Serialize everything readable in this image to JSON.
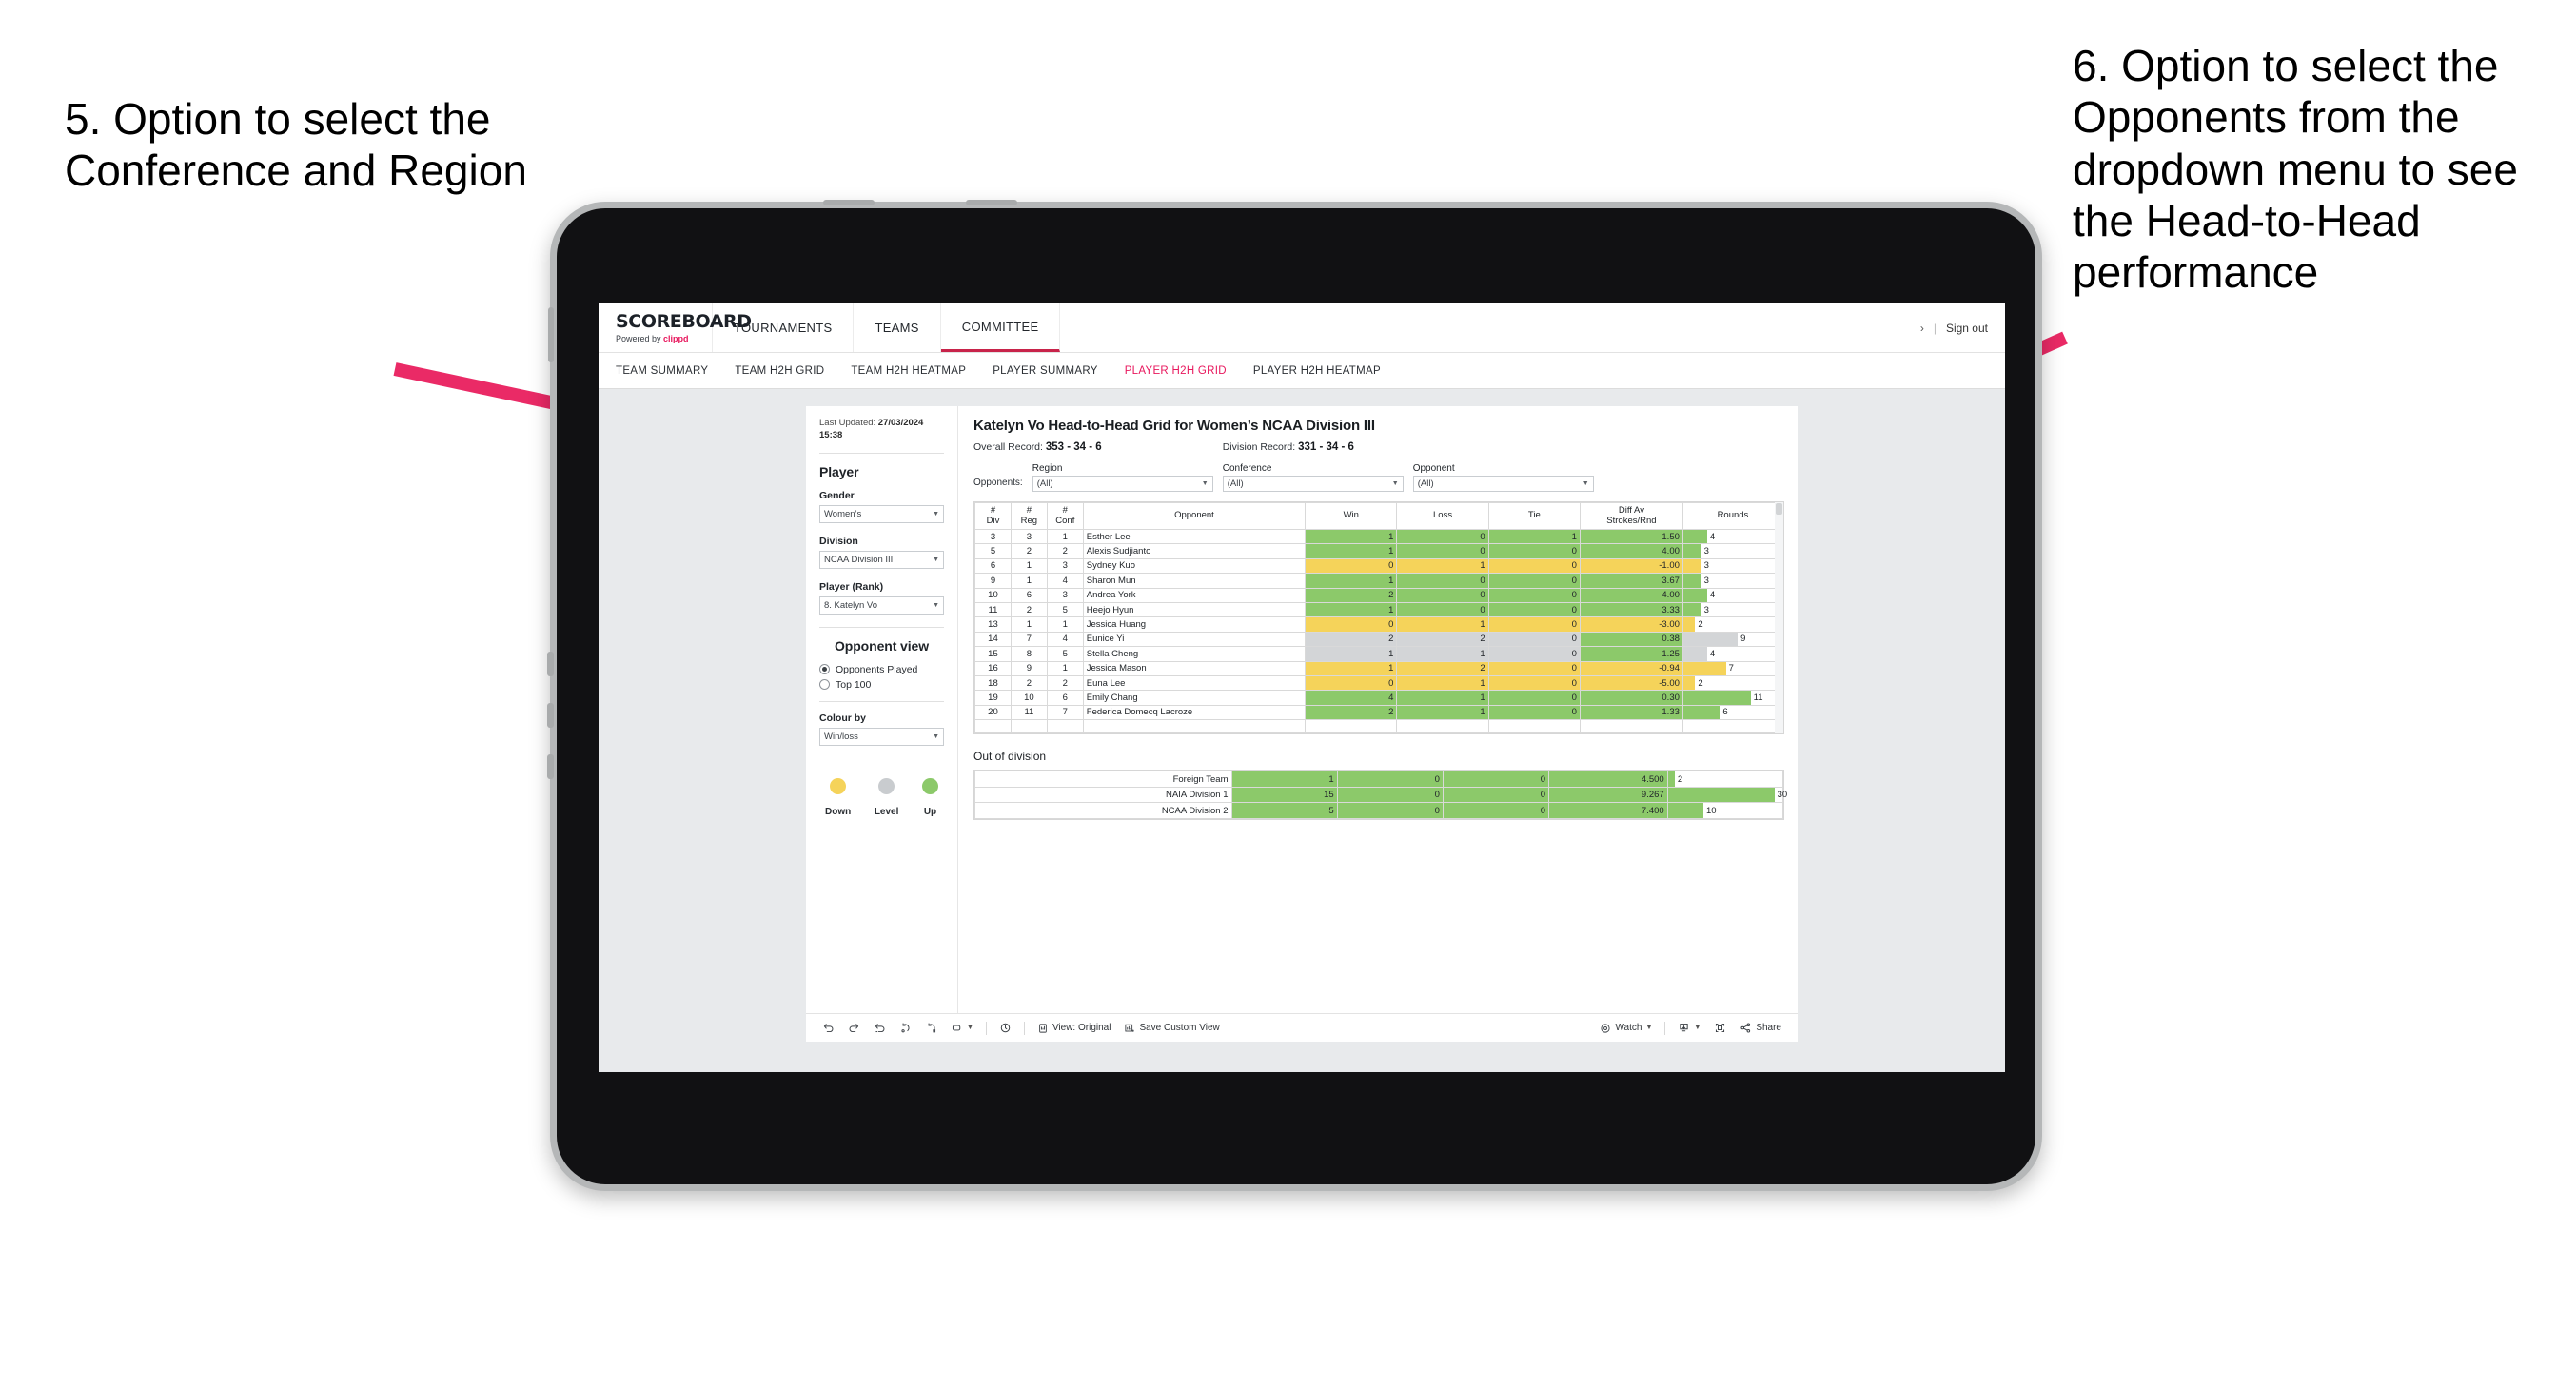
{
  "annotations": {
    "left": "5. Option to select the Conference and Region",
    "right": "6. Option to select the Opponents from the dropdown menu to see the Head-to-Head performance"
  },
  "app": {
    "brand": {
      "title": "SCOREBOARD",
      "powered_prefix": "Powered by",
      "powered_name": "clippd"
    },
    "topnav": [
      {
        "label": "TOURNAMENTS",
        "active": false
      },
      {
        "label": "TEAMS",
        "active": false
      },
      {
        "label": "COMMITTEE",
        "active": true
      }
    ],
    "topnav_right": {
      "user_glyph": "›",
      "separator": "|",
      "sign_out": "Sign out"
    },
    "subnav": [
      {
        "label": "TEAM SUMMARY",
        "active": false
      },
      {
        "label": "TEAM H2H GRID",
        "active": false
      },
      {
        "label": "TEAM H2H HEATMAP",
        "active": false
      },
      {
        "label": "PLAYER SUMMARY",
        "active": false
      },
      {
        "label": "PLAYER H2H GRID",
        "active": true
      },
      {
        "label": "PLAYER H2H HEATMAP",
        "active": false
      }
    ]
  },
  "panel": {
    "last_updated_label": "Last Updated:",
    "last_updated_date": "27/03/2024",
    "last_updated_time": "15:38",
    "player_heading": "Player",
    "gender_label": "Gender",
    "gender_value": "Women’s",
    "division_label": "Division",
    "division_value": "NCAA Division III",
    "player_rank_label": "Player (Rank)",
    "player_rank_value": "8. Katelyn Vo",
    "opponent_view_heading": "Opponent view",
    "opponent_view_options": [
      {
        "label": "Opponents Played",
        "selected": true
      },
      {
        "label": "Top 100",
        "selected": false
      }
    ],
    "colour_by_label": "Colour by",
    "colour_by_value": "Win/loss",
    "legend": [
      {
        "label": "Down",
        "color": "#F5D35A"
      },
      {
        "label": "Level",
        "color": "#C9CCCF"
      },
      {
        "label": "Up",
        "color": "#8CC96A"
      }
    ]
  },
  "view": {
    "title": "Katelyn Vo Head-to-Head Grid for Women’s NCAA Division III",
    "overall_record_label": "Overall Record:",
    "overall_record_value": "353 -  34 - 6",
    "division_record_label": "Division Record:",
    "division_record_value": "331 -  34 - 6",
    "opponents_label": "Opponents:",
    "filters": [
      {
        "label": "Region",
        "value": "(All)"
      },
      {
        "label": "Conference",
        "value": "(All)"
      },
      {
        "label": "Opponent",
        "value": "(All)"
      }
    ]
  },
  "chart_data": {
    "type": "table",
    "title": "Katelyn Vo Head-to-Head Grid for Women’s NCAA Division III",
    "columns": [
      "# Div",
      "# Reg",
      "# Conf",
      "Opponent",
      "Win",
      "Loss",
      "Tie",
      "Diff Av Strokes/Rnd",
      "Rounds"
    ],
    "column_header_lines": [
      [
        "#",
        "Div"
      ],
      [
        "#",
        "Reg"
      ],
      [
        "#",
        "Conf"
      ],
      [
        "Opponent"
      ],
      [
        "Win"
      ],
      [
        "Loss"
      ],
      [
        "Tie"
      ],
      [
        "Diff Av",
        "Strokes/Rnd"
      ],
      [
        "Rounds"
      ]
    ],
    "rows": [
      {
        "div": "3",
        "reg": "3",
        "conf": "1",
        "opponent": "Esther Lee",
        "win": "1",
        "loss": "0",
        "tie": "1",
        "diff": "1.50",
        "rounds": "4",
        "color": "#8CC96A",
        "diff_color": "#8CC96A",
        "bar_pct": 24
      },
      {
        "div": "5",
        "reg": "2",
        "conf": "2",
        "opponent": "Alexis Sudjianto",
        "win": "1",
        "loss": "0",
        "tie": "0",
        "diff": "4.00",
        "rounds": "3",
        "color": "#8CC96A",
        "diff_color": "#8CC96A",
        "bar_pct": 18
      },
      {
        "div": "6",
        "reg": "1",
        "conf": "3",
        "opponent": "Sydney Kuo",
        "win": "0",
        "loss": "1",
        "tie": "0",
        "diff": "-1.00",
        "rounds": "3",
        "color": "#F5D35A",
        "diff_color": "#F5D35A",
        "bar_pct": 18
      },
      {
        "div": "9",
        "reg": "1",
        "conf": "4",
        "opponent": "Sharon Mun",
        "win": "1",
        "loss": "0",
        "tie": "0",
        "diff": "3.67",
        "rounds": "3",
        "color": "#8CC96A",
        "diff_color": "#8CC96A",
        "bar_pct": 18
      },
      {
        "div": "10",
        "reg": "6",
        "conf": "3",
        "opponent": "Andrea York",
        "win": "2",
        "loss": "0",
        "tie": "0",
        "diff": "4.00",
        "rounds": "4",
        "color": "#8CC96A",
        "diff_color": "#8CC96A",
        "bar_pct": 24
      },
      {
        "div": "11",
        "reg": "2",
        "conf": "5",
        "opponent": "Heejo Hyun",
        "win": "1",
        "loss": "0",
        "tie": "0",
        "diff": "3.33",
        "rounds": "3",
        "color": "#8CC96A",
        "diff_color": "#8CC96A",
        "bar_pct": 18
      },
      {
        "div": "13",
        "reg": "1",
        "conf": "1",
        "opponent": "Jessica Huang",
        "win": "0",
        "loss": "1",
        "tie": "0",
        "diff": "-3.00",
        "rounds": "2",
        "color": "#F5D35A",
        "diff_color": "#F5D35A",
        "bar_pct": 12
      },
      {
        "div": "14",
        "reg": "7",
        "conf": "4",
        "opponent": "Eunice Yi",
        "win": "2",
        "loss": "2",
        "tie": "0",
        "diff": "0.38",
        "rounds": "9",
        "color": "#D3D5D7",
        "diff_color": "#8CC96A",
        "bar_pct": 55
      },
      {
        "div": "15",
        "reg": "8",
        "conf": "5",
        "opponent": "Stella Cheng",
        "win": "1",
        "loss": "1",
        "tie": "0",
        "diff": "1.25",
        "rounds": "4",
        "color": "#D3D5D7",
        "diff_color": "#8CC96A",
        "bar_pct": 24
      },
      {
        "div": "16",
        "reg": "9",
        "conf": "1",
        "opponent": "Jessica Mason",
        "win": "1",
        "loss": "2",
        "tie": "0",
        "diff": "-0.94",
        "rounds": "7",
        "color": "#F5D35A",
        "diff_color": "#F5D35A",
        "bar_pct": 43
      },
      {
        "div": "18",
        "reg": "2",
        "conf": "2",
        "opponent": "Euna Lee",
        "win": "0",
        "loss": "1",
        "tie": "0",
        "diff": "-5.00",
        "rounds": "2",
        "color": "#F5D35A",
        "diff_color": "#F5D35A",
        "bar_pct": 12
      },
      {
        "div": "19",
        "reg": "10",
        "conf": "6",
        "opponent": "Emily Chang",
        "win": "4",
        "loss": "1",
        "tie": "0",
        "diff": "0.30",
        "rounds": "11",
        "color": "#8CC96A",
        "diff_color": "#8CC96A",
        "bar_pct": 68
      },
      {
        "div": "20",
        "reg": "11",
        "conf": "7",
        "opponent": "Federica Domecq Lacroze",
        "win": "2",
        "loss": "1",
        "tie": "0",
        "diff": "1.33",
        "rounds": "6",
        "color": "#8CC96A",
        "diff_color": "#8CC96A",
        "bar_pct": 37
      }
    ],
    "out_of_division_title": "Out of division",
    "out_of_division": [
      {
        "label": "Foreign Team",
        "win": "1",
        "loss": "0",
        "tie": "0",
        "diff": "4.500",
        "rounds": "2",
        "color": "#8CC96A",
        "bar_pct": 6
      },
      {
        "label": "NAIA Division 1",
        "win": "15",
        "loss": "0",
        "tie": "0",
        "diff": "9.267",
        "rounds": "30",
        "color": "#8CC96A",
        "bar_pct": 93
      },
      {
        "label": "NCAA Division 2",
        "win": "5",
        "loss": "0",
        "tie": "0",
        "diff": "7.400",
        "rounds": "10",
        "color": "#8CC96A",
        "bar_pct": 31
      }
    ]
  },
  "toolbar": {
    "view_label": "View: Original",
    "save_label": "Save Custom View",
    "watch_label": "Watch",
    "share_label": "Share"
  }
}
